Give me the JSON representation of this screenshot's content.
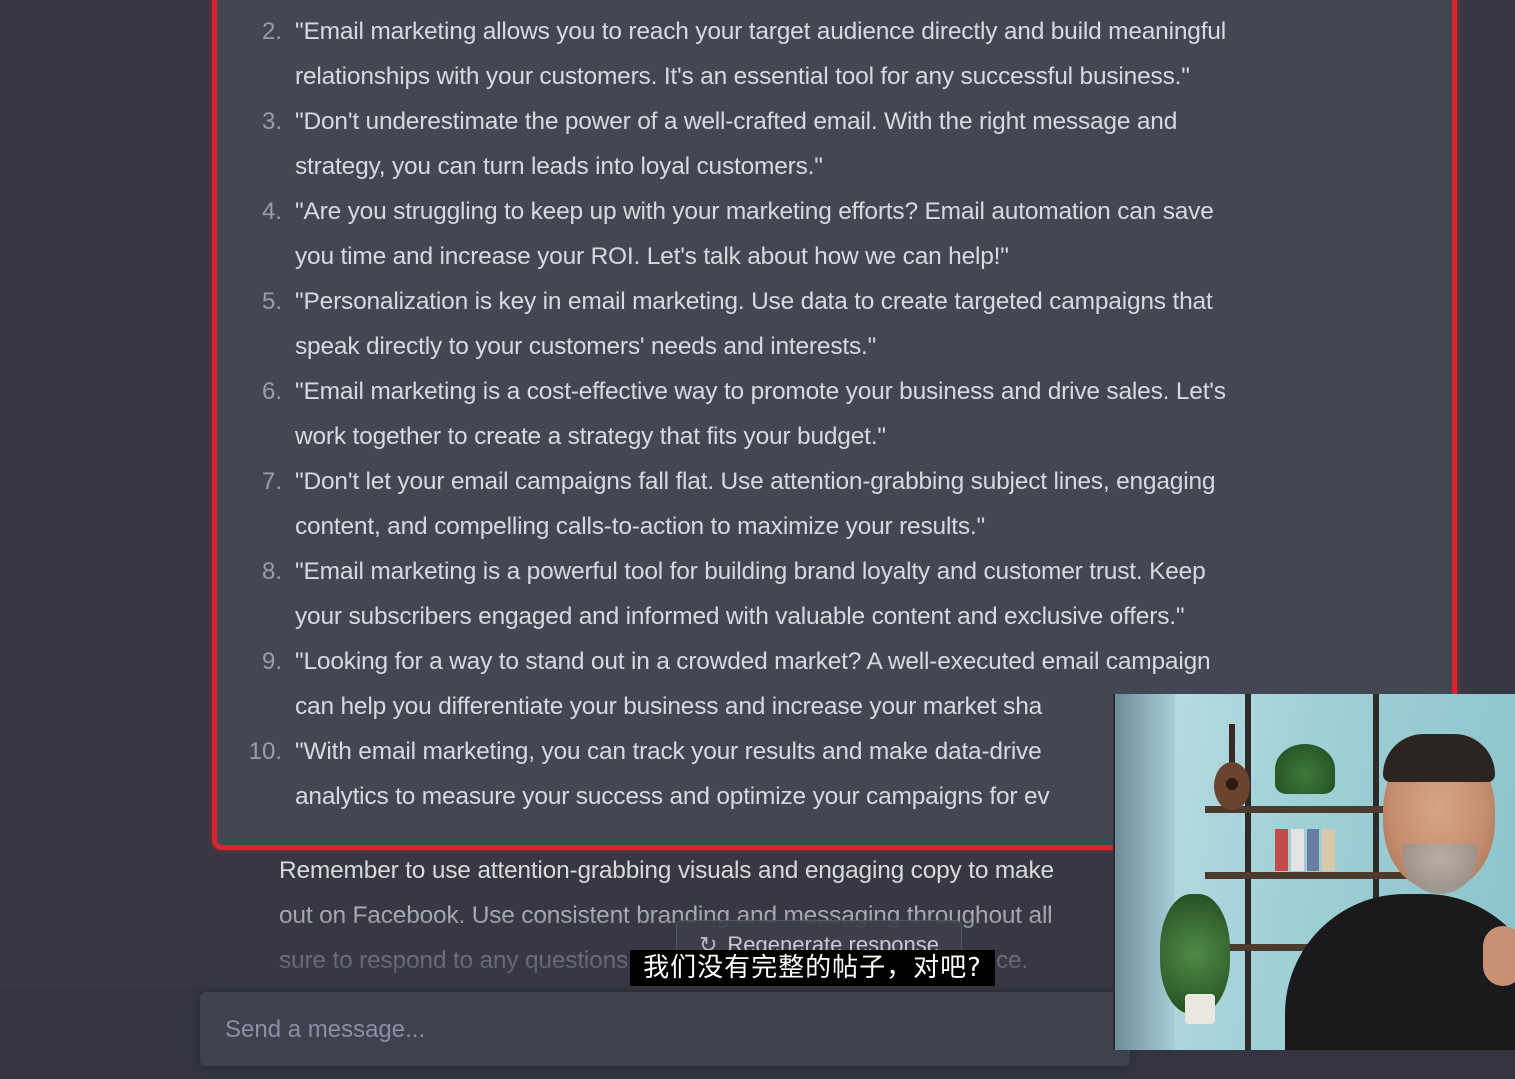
{
  "chat": {
    "list_items": [
      {
        "number": "2.",
        "line1": "\"Email marketing allows you to reach your target audience directly and build meaningful",
        "line2": "relationships with your customers. It's an essential tool for any successful business.\""
      },
      {
        "number": "3.",
        "line1": "\"Don't underestimate the power of a well-crafted email. With the right message and",
        "line2": "strategy, you can turn leads into loyal customers.\""
      },
      {
        "number": "4.",
        "line1": "\"Are you struggling to keep up with your marketing efforts? Email automation can save",
        "line2": "you time and increase your ROI. Let's talk about how we can help!\""
      },
      {
        "number": "5.",
        "line1": "\"Personalization is key in email marketing. Use data to create targeted campaigns that",
        "line2": "speak directly to your customers' needs and interests.\""
      },
      {
        "number": "6.",
        "line1": "\"Email marketing is a cost-effective way to promote your business and drive sales. Let's",
        "line2": "work together to create a strategy that fits your budget.\""
      },
      {
        "number": "7.",
        "line1": "\"Don't let your email campaigns fall flat. Use attention-grabbing subject lines, engaging",
        "line2": "content, and compelling calls-to-action to maximize your results.\""
      },
      {
        "number": "8.",
        "line1": "\"Email marketing is a powerful tool for building brand loyalty and customer trust. Keep",
        "line2": "your subscribers engaged and informed with valuable content and exclusive offers.\""
      },
      {
        "number": "9.",
        "line1": "\"Looking for a way to stand out in a crowded market? A well-executed email campaign",
        "line2": "can help you differentiate your business and increase your market sha"
      },
      {
        "number": "10.",
        "line1": "\"With email marketing, you can track your results and make data-drive",
        "line2": "analytics to measure your success and optimize your campaigns for ev"
      }
    ],
    "trailing_lines": [
      "Remember to use attention-grabbing visuals and engaging copy to make",
      "out on Facebook. Use consistent branding and messaging throughout all",
      "sure to respond to any questions"
    ],
    "trailing_tail": "ce."
  },
  "regenerate": {
    "icon": "refresh-icon",
    "label": "Regenerate response"
  },
  "subtitle": "我们没有完整的帖子，对吧?",
  "composer": {
    "placeholder": "Send a message..."
  },
  "colors": {
    "background": "#343541",
    "highlight_border": "#d6262c",
    "text": "#d8d9df"
  }
}
